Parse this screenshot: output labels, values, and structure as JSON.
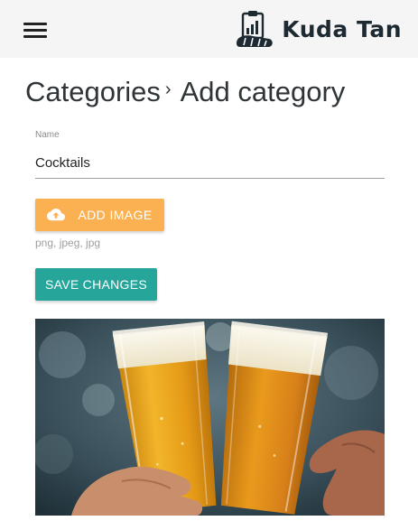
{
  "header": {
    "brand_name": "Kuda Tan",
    "icons": {
      "menu": "hamburger-menu-icon",
      "logo": "clipboard-logo-icon"
    }
  },
  "breadcrumb": {
    "parent": "Categories",
    "separator": "›",
    "current": "Add category"
  },
  "form": {
    "name_label": "Name",
    "name_value": "Cocktails",
    "add_image_label": "ADD IMAGE",
    "add_image_icon": "cloud-upload-icon",
    "hint": "png, jpeg, jpg",
    "save_label": "SAVE CHANGES"
  },
  "colors": {
    "header_bg": "#f5f5f5",
    "add_image_button": "#fbb151",
    "save_button": "#26a69a",
    "brand_text": "#1e2a32"
  }
}
